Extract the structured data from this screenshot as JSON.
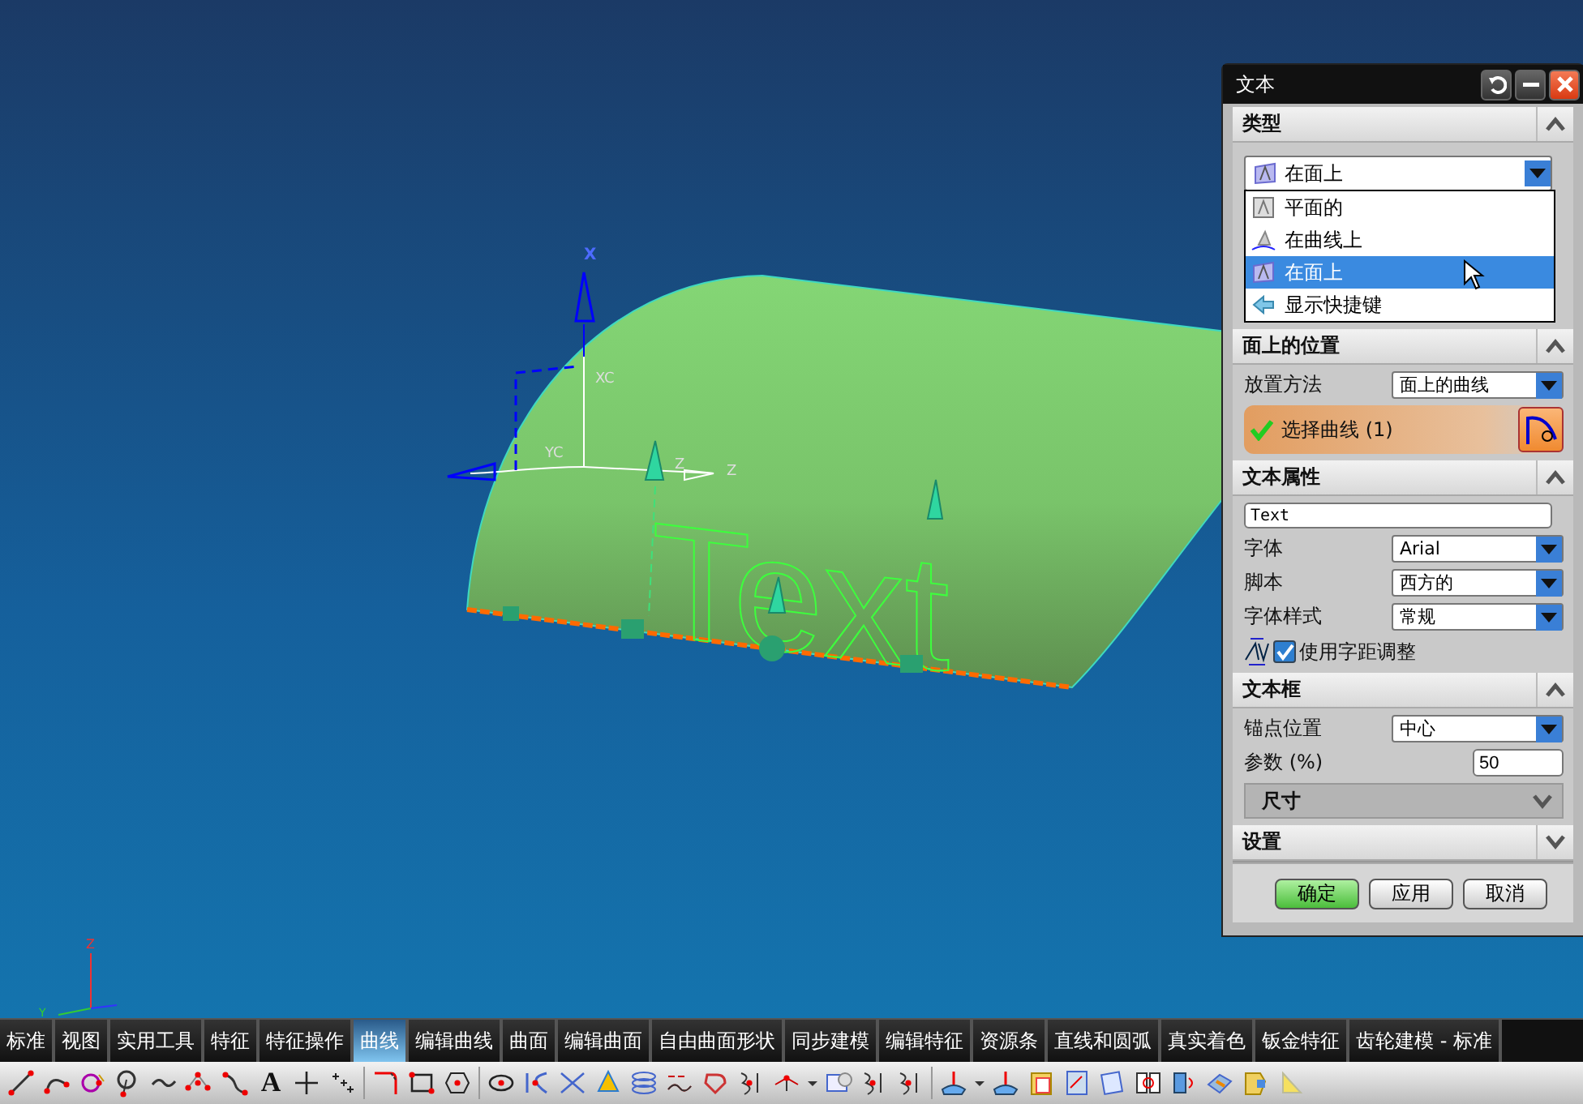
{
  "viewport": {
    "model_text": "Text",
    "axis_labels": [
      "X",
      "XC",
      "YC",
      "Z",
      "Z"
    ],
    "triad_labels": [
      "Z",
      "Y"
    ]
  },
  "dialog": {
    "title": "文本",
    "sections": [
      {
        "kind": "type",
        "title": "类型",
        "expanded": true,
        "value": "在面上",
        "options": [
          {
            "label": "平面的",
            "selected": false
          },
          {
            "label": "在曲线上",
            "selected": false
          },
          {
            "label": "在面上",
            "selected": true
          },
          {
            "label": "显示快捷键",
            "selected": false
          }
        ]
      },
      {
        "kind": "placement",
        "title": "面上的位置",
        "expanded": true,
        "method_label": "放置方法",
        "method_value": "面上的曲线",
        "selection_label": "选择曲线 (1)"
      },
      {
        "kind": "properties",
        "title": "文本属性",
        "expanded": true,
        "text_value": "Text",
        "rows": [
          {
            "label": "字体",
            "value": "Arial"
          },
          {
            "label": "脚本",
            "value": "西方的"
          },
          {
            "label": "字体样式",
            "value": "常规"
          }
        ],
        "kerning_label": "使用字距调整",
        "kerning_checked": true
      },
      {
        "kind": "frame",
        "title": "文本框",
        "expanded": true,
        "anchor_label": "锚点位置",
        "anchor_value": "中心",
        "param_label": "参数 (%)",
        "param_value": "50",
        "subsection": {
          "title": "尺寸",
          "expanded": false
        }
      },
      {
        "kind": "settings",
        "title": "设置",
        "expanded": false
      }
    ],
    "buttons": [
      {
        "label": "确定",
        "default": true
      },
      {
        "label": "应用",
        "default": false
      },
      {
        "label": "取消",
        "default": false
      }
    ]
  },
  "tabs": [
    {
      "label": "标准",
      "selected": false
    },
    {
      "label": "视图",
      "selected": false
    },
    {
      "label": "实用工具",
      "selected": false
    },
    {
      "label": "特征",
      "selected": false
    },
    {
      "label": "特征操作",
      "selected": false
    },
    {
      "label": "曲线",
      "selected": true
    },
    {
      "label": "编辑曲线",
      "selected": false
    },
    {
      "label": "曲面",
      "selected": false
    },
    {
      "label": "编辑曲面",
      "selected": false
    },
    {
      "label": "自由曲面形状",
      "selected": false
    },
    {
      "label": "同步建模",
      "selected": false
    },
    {
      "label": "编辑特征",
      "selected": false
    },
    {
      "label": "资源条",
      "selected": false
    },
    {
      "label": "直线和圆弧",
      "selected": false
    },
    {
      "label": "真实着色",
      "selected": false
    },
    {
      "label": "钣金特征",
      "selected": false
    },
    {
      "label": "齿轮建模 - 标准",
      "selected": false
    }
  ],
  "toolbar": {
    "text_tool_glyph": "A"
  }
}
